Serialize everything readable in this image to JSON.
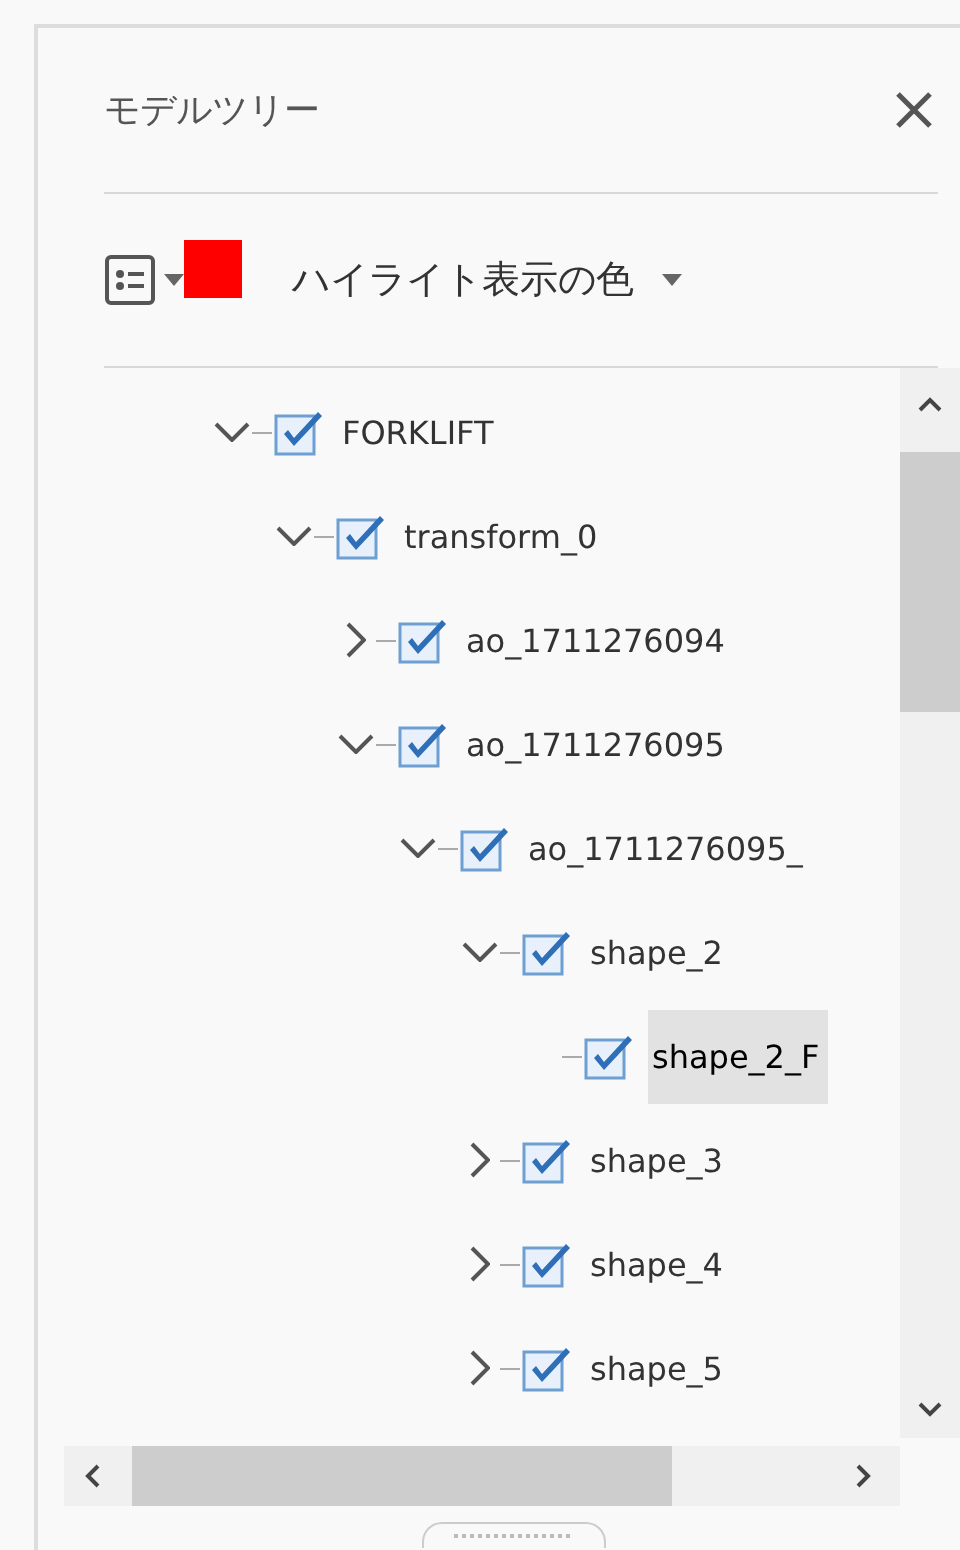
{
  "panel": {
    "title": "モデルツリー"
  },
  "toolbar": {
    "highlight": {
      "color": "#ff0000",
      "label": "ハイライト表示の色"
    }
  },
  "tree": [
    {
      "label": "FORKLIFT",
      "checked": true,
      "expanded": true,
      "selected": false,
      "children": [
        {
          "label": "transform_0",
          "checked": true,
          "expanded": true,
          "selected": false,
          "children": [
            {
              "label": "ao_1711276094",
              "checked": true,
              "expanded": false,
              "selected": false
            },
            {
              "label": "ao_1711276095",
              "checked": true,
              "expanded": true,
              "selected": false,
              "children": [
                {
                  "label": "ao_1711276095_",
                  "checked": true,
                  "expanded": true,
                  "selected": false,
                  "children": [
                    {
                      "label": "shape_2",
                      "checked": true,
                      "expanded": true,
                      "selected": false,
                      "children": [
                        {
                          "label": "shape_2_F",
                          "checked": true,
                          "selected": true
                        }
                      ]
                    },
                    {
                      "label": "shape_3",
                      "checked": true,
                      "expanded": false,
                      "selected": false
                    },
                    {
                      "label": "shape_4",
                      "checked": true,
                      "expanded": false,
                      "selected": false
                    },
                    {
                      "label": "shape_5",
                      "checked": true,
                      "expanded": false,
                      "selected": false
                    }
                  ]
                }
              ]
            }
          ]
        }
      ]
    }
  ]
}
